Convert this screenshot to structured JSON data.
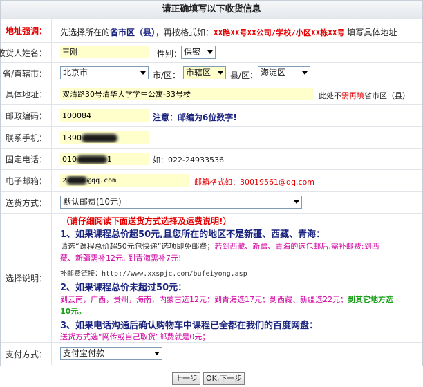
{
  "title": "请正确填写以下收货信息",
  "notice": {
    "label": "地址强调：",
    "pre": "先选择所在的",
    "highlight": "省市区（县）",
    "mid": "，再按格式如：",
    "example": "XX路XX号XX公司/学校/小区XX栋XX号",
    "post": " 填写具体地址"
  },
  "receiver": {
    "label": "收货人姓名：",
    "value": "王刚",
    "gender_label": "性别：",
    "gender_value": "保密"
  },
  "region": {
    "label": "省/直辖市：",
    "province": "北京市",
    "city_label": "市/区：",
    "city": "市辖区",
    "county_label": "县/区：",
    "county": "海淀区"
  },
  "address": {
    "label": "具体地址：",
    "value": "双清路30号清华大学学生公寓-33号楼",
    "hint_pre": "此处不",
    "hint_em": "需再填",
    "hint_post": "省市区（县）"
  },
  "postcode": {
    "label": "邮政编码：",
    "value": "100084",
    "note": "注意：邮编为6位数字!"
  },
  "mobile": {
    "label": "联系手机：",
    "value_prefix": "1390"
  },
  "phone": {
    "label": "固定电话：",
    "value_prefix": "010",
    "value_suffix": "1",
    "hint": "如：022-24933536"
  },
  "email": {
    "label": "电子邮箱：",
    "value_prefix": "2",
    "value_suffix": "@qq.com",
    "hint": "邮箱格式如：30019561@qq.com"
  },
  "shipping": {
    "label": "送货方式：",
    "value": "默认邮费(10元)"
  },
  "explain": {
    "label": "选择说明：",
    "header": "（请仔细阅读下面送货方式选择及运费说明!）",
    "item1_title": "1、如果课程总价超50元,且您所在的地区不是新疆、西藏、青海：",
    "item1_line1_a": "请选“课程总价超50元包快递”选项即免邮费；",
    "item1_line1_b": "若到西藏、新疆、青海的选包邮后,需补邮费:到西",
    "item1_line2": "藏、新疆需补12元, 到青海需补7元!",
    "item1_link": "补邮费链接：http://www.xxspjc.com/bufeiyong.asp",
    "item2_title": "2、如果课程总价未超过50元：",
    "item2_line1_a": "到云南，广西，贵州，海南，内蒙古选12元；到青海选17元；到西藏、新疆选22元；",
    "item2_line1_b": "到其它地方选",
    "item2_line2": "10元。",
    "item3_title": "3、如果电话沟通后确认购物车中课程已全都在我们的百度网盘：",
    "item3_line": "送货方式选“网传或自己取货”邮费就是0元；"
  },
  "payment": {
    "label": "支付方式：",
    "value": "支付宝付款"
  },
  "buttons": {
    "prev": "上一步",
    "next": "OK,下一步"
  }
}
